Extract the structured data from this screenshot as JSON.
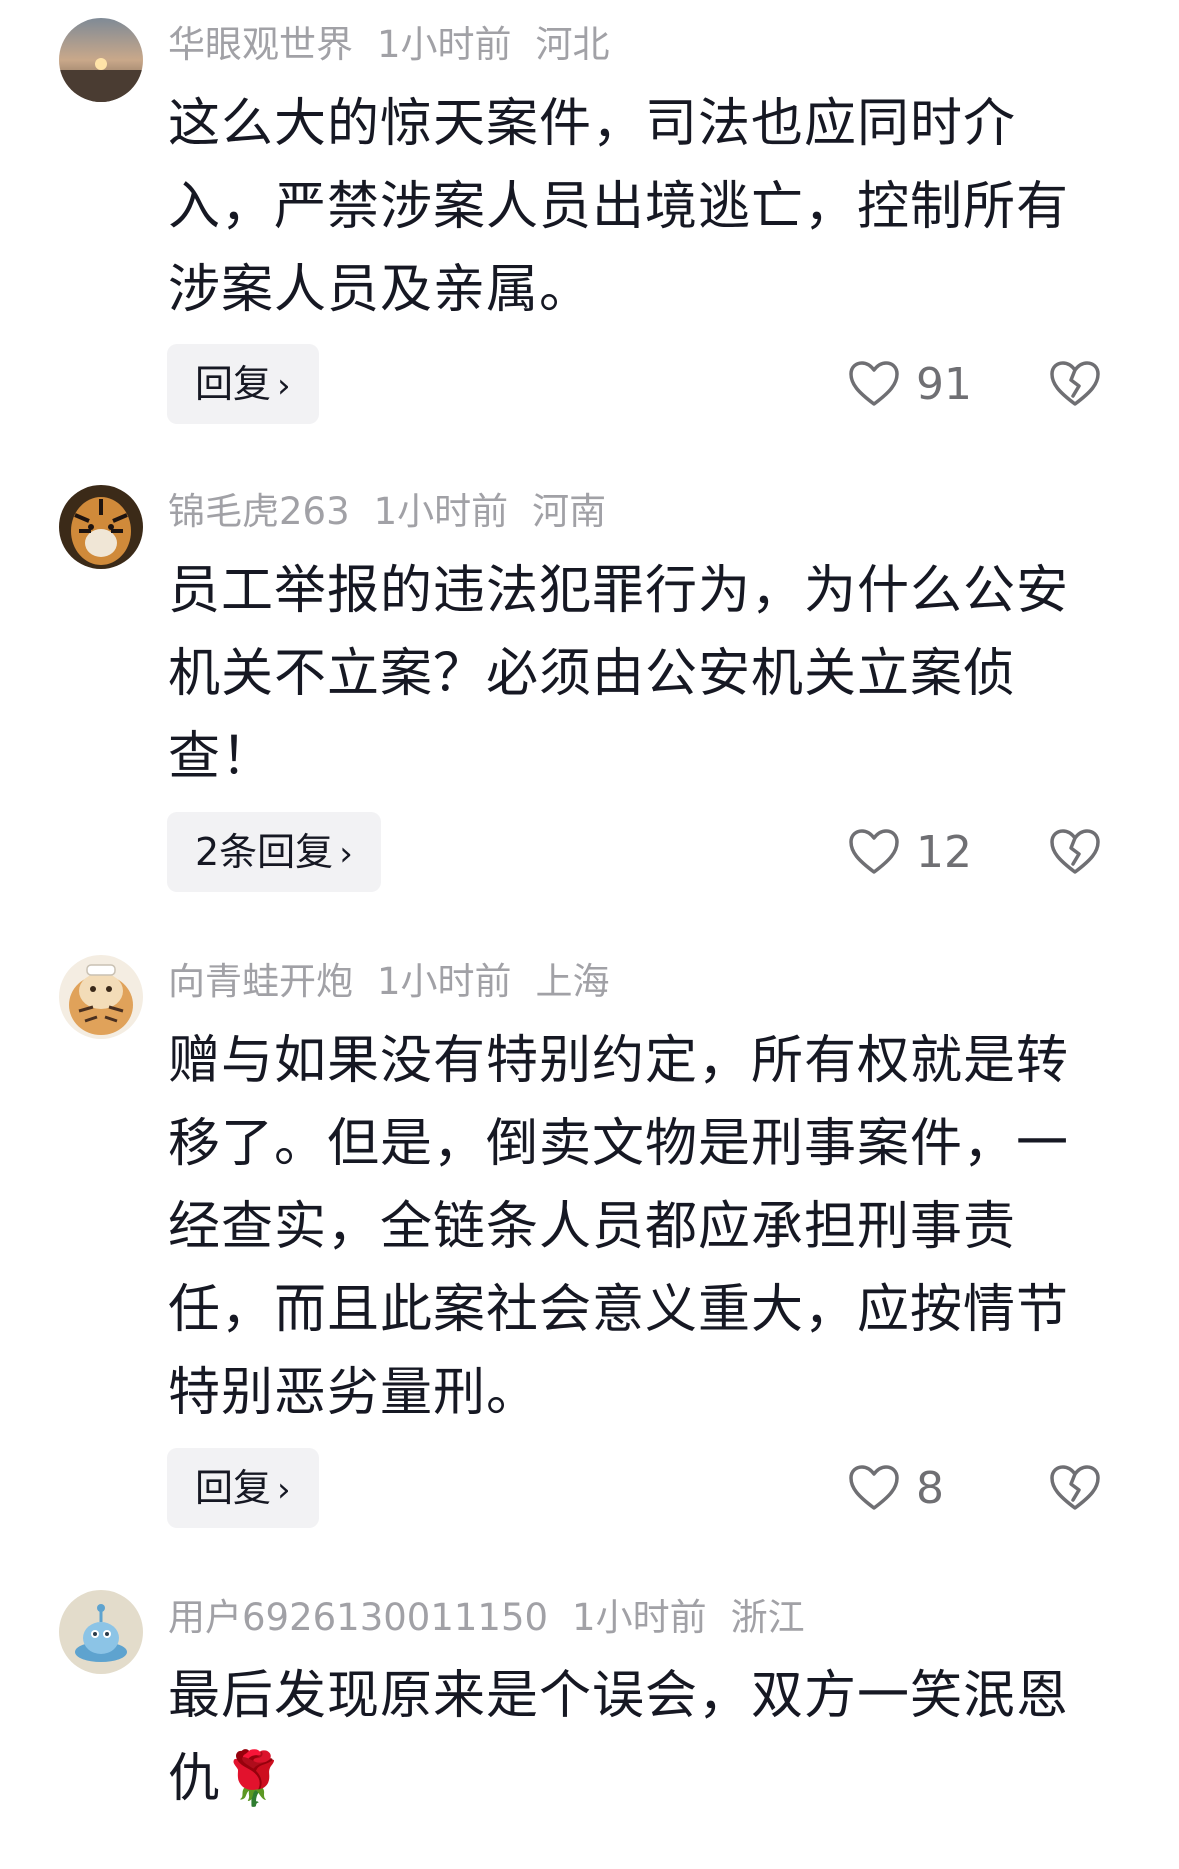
{
  "comments": [
    {
      "username": "华眼观世界",
      "time": "1小时前",
      "location": "河北",
      "text": "这么大的惊天案件，司法也应同时介入，严禁涉案人员出境逃亡，控制所有涉案人员及亲属。",
      "reply_label": "回复",
      "likes": "91"
    },
    {
      "username": "锦毛虎263",
      "time": "1小时前",
      "location": "河南",
      "text": "员工举报的违法犯罪行为，为什么公安机关不立案？必须由公安机关立案侦查！",
      "reply_label": "2条回复",
      "likes": "12"
    },
    {
      "username": "向青蛙开炮",
      "time": "1小时前",
      "location": "上海",
      "text": "赠与如果没有特别约定，所有权就是转移了。但是，倒卖文物是刑事案件，一经查实，全链条人员都应承担刑事责任，而且此案社会意义重大，应按情节特别恶劣量刑。",
      "reply_label": "回复",
      "likes": "8"
    },
    {
      "username": "用户6926130011150",
      "time": "1小时前",
      "location": "浙江",
      "text": "最后发现原来是个误会，双方一笑泯恩仇🌹"
    }
  ],
  "icons": {
    "like": "heart-outline-icon",
    "dislike": "broken-heart-outline-icon",
    "chevron": "chevron-right-icon"
  },
  "colors": {
    "meta": "#a1a1a6",
    "text": "#161823",
    "button_bg": "#f2f2f4"
  }
}
